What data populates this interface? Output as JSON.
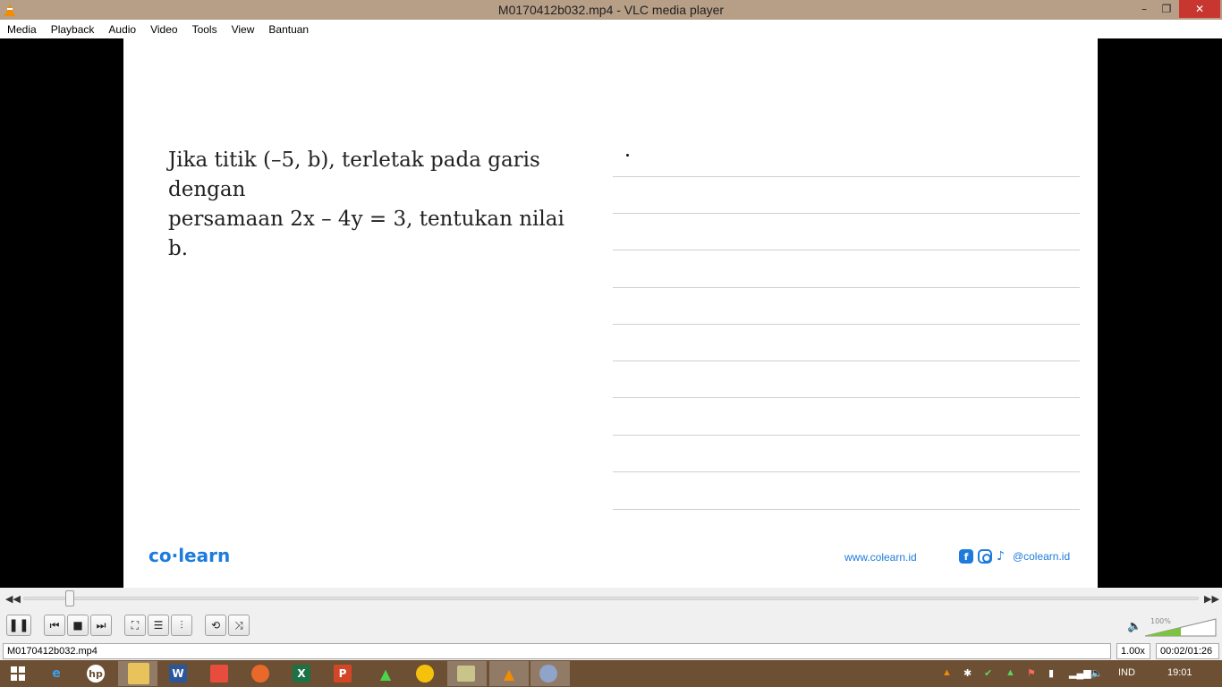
{
  "window": {
    "title": "M0170412b032.mp4 - VLC media player",
    "minimize": "–",
    "maximize": "❐",
    "close": "✕"
  },
  "menu": [
    "Media",
    "Playback",
    "Audio",
    "Video",
    "Tools",
    "View",
    "Bantuan"
  ],
  "video": {
    "question_line1": "Jika titik (–5, b), terletak pada garis dengan",
    "question_line2": "persamaan 2x – 4y = 3, tentukan nilai b.",
    "brand": "co·learn",
    "url": "www.colearn.id",
    "handle": "@colearn.id"
  },
  "controls": {
    "seek_position": 0.036,
    "volume_label": "100%",
    "volume_level": 1.0,
    "filename": "M0170412b032.mp4",
    "speed": "1.00x",
    "time": "00:02/01:26"
  },
  "taskbar": {
    "language": "IND",
    "clock": "19:01"
  },
  "colors": {
    "titlebar": "#b79e87",
    "brand_blue": "#1e7bdc",
    "taskbar": "#6d4f33"
  }
}
